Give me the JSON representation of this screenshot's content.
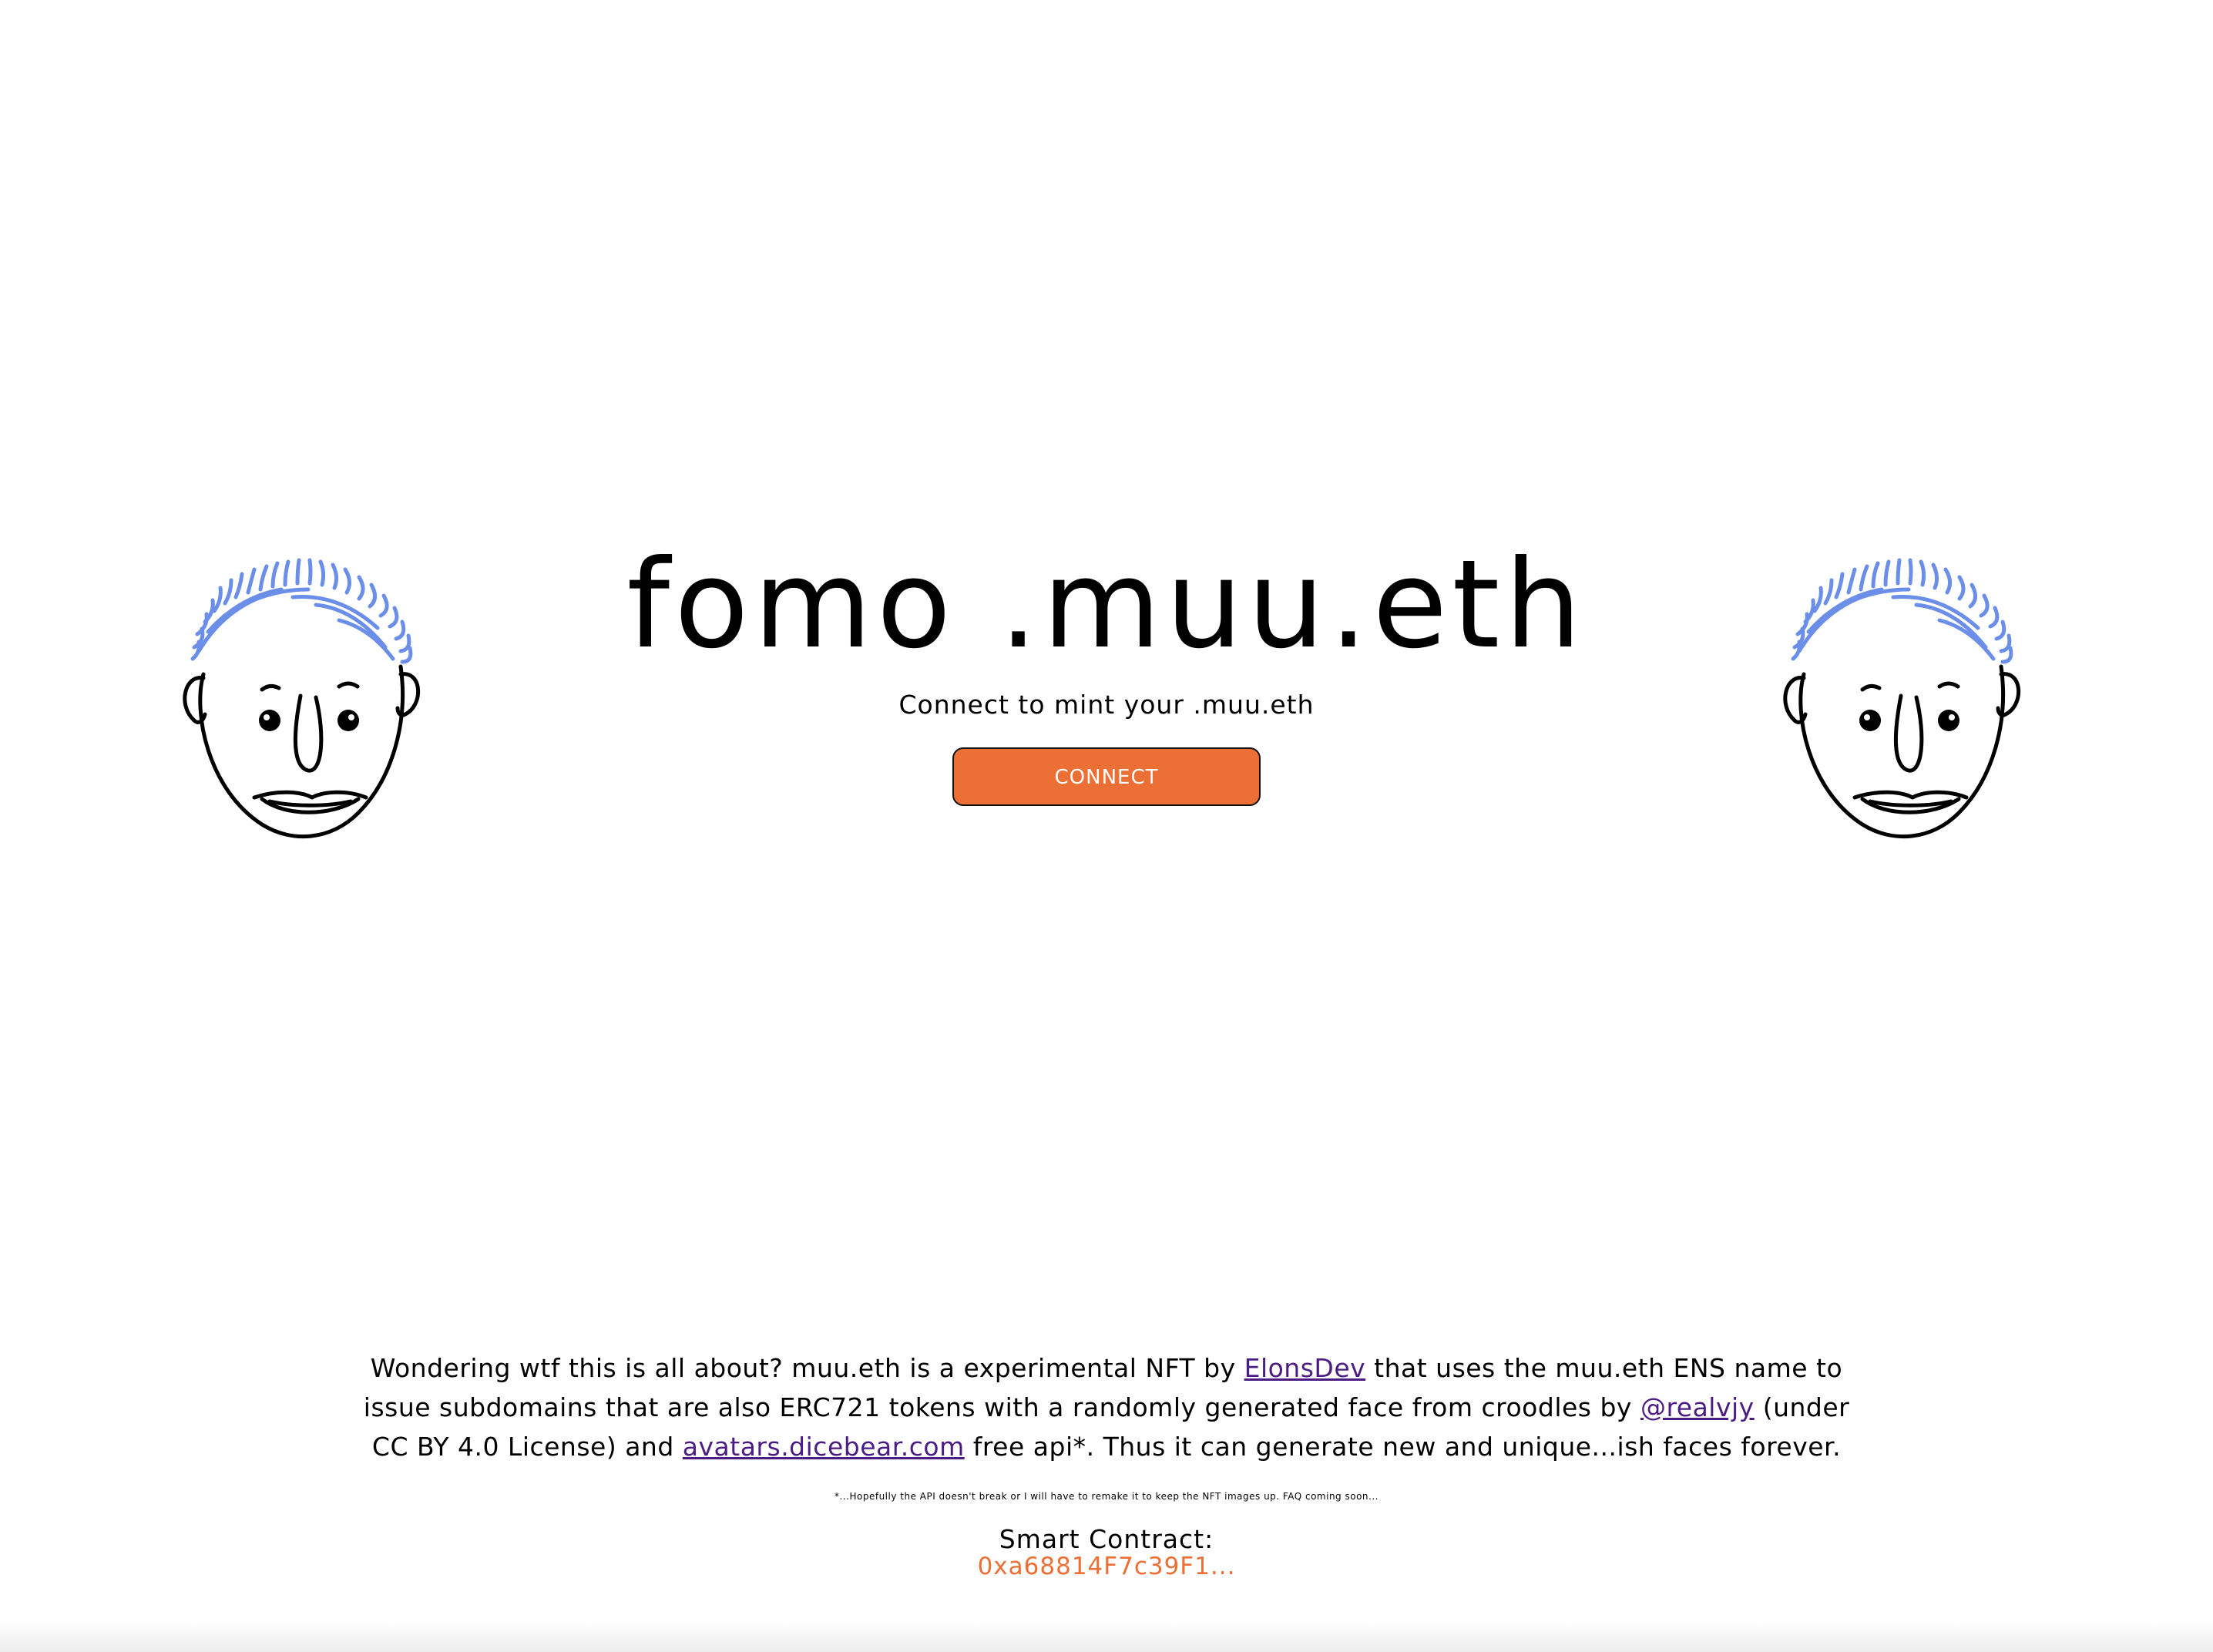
{
  "hero": {
    "title": "fomo .muu.eth",
    "subtitle": "Connect to mint your .muu.eth",
    "connect_label": "CONNECT"
  },
  "about": {
    "text_1": "Wondering wtf this is all about? muu.eth is a experimental NFT by ",
    "link_elonsdev": "ElonsDev",
    "text_2": " that uses the muu.eth ENS name to issue subdomains that are also ERC721 tokens with a randomly generated face from croodles by ",
    "link_realvjy": "@realvjy",
    "text_3": " (under CC BY 4.0 License) and ",
    "link_dicebear": "avatars.dicebear.com",
    "text_4": " free api*. Thus it can generate new and unique...ish faces forever.",
    "footnote": "*...Hopefully the API doesn't break or I will have to remake it to keep the NFT images up. FAQ coming soon..."
  },
  "contract": {
    "label": "Smart Contract:",
    "address": "0xa68814F7c39F1..."
  },
  "colors": {
    "accent": "#ec6f35",
    "link": "#4b1c84",
    "hair": "#6b8ee8",
    "text": "#000000",
    "background": "#ffffff"
  },
  "icons": {
    "left_face": "doodle-face-icon",
    "right_face": "doodle-face-icon"
  }
}
